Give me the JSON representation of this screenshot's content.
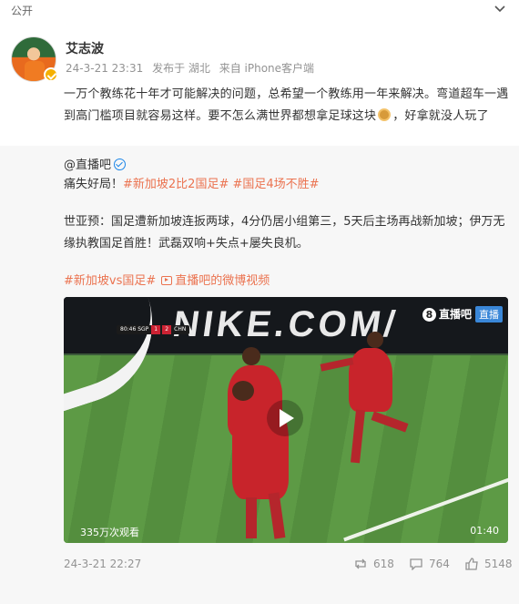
{
  "topbar": {
    "visibility": "公开",
    "menu_icon": "chevron-down-icon"
  },
  "post": {
    "author": "艾志波",
    "timestamp": "24-3-21 23:31",
    "location": "发布于 湖北",
    "source": "来自 iPhone客户端",
    "text_part1": "一万个教练花十年才可能解决的问题，总希望一个教练用一年来解决。弯道超车一遇到高门槛项目就容易这样。要不怎么满世界都想拿足球这块",
    "text_part2": "，好拿就没人玩了",
    "emoji_icon": "medal-icon"
  },
  "repost": {
    "author": "@直播吧",
    "line1_prefix": "痛失好局！",
    "tag1": "#新加坡2比2国足#",
    "tag2": "#国足4场不胜#",
    "paragraph": "世亚预：国足遭新加坡连扳两球，4分仍居小组第三，5天后主场再战新加坡；伊万无缘执教国足首胜！武磊双响+失点+屡失良机。",
    "tag3": "#新加坡vs国足#",
    "video_link": "直播吧的微博视频",
    "video": {
      "scoreboard_clock": "80:46",
      "team1": "SGP",
      "score1": "1",
      "score2": "2",
      "team2": "CHN",
      "brand": "NIKE.COM/",
      "watermark": "直播吧",
      "live_tag": "直播",
      "views": "335万次观看",
      "duration": "01:40"
    },
    "footer": {
      "time": "24-3-21 22:27",
      "reposts": "618",
      "comments": "764",
      "likes": "5148"
    }
  },
  "colors": {
    "accent": "#eb7350",
    "meta": "#939393",
    "verified": "#1c86e8",
    "vip": "#f5b000"
  }
}
